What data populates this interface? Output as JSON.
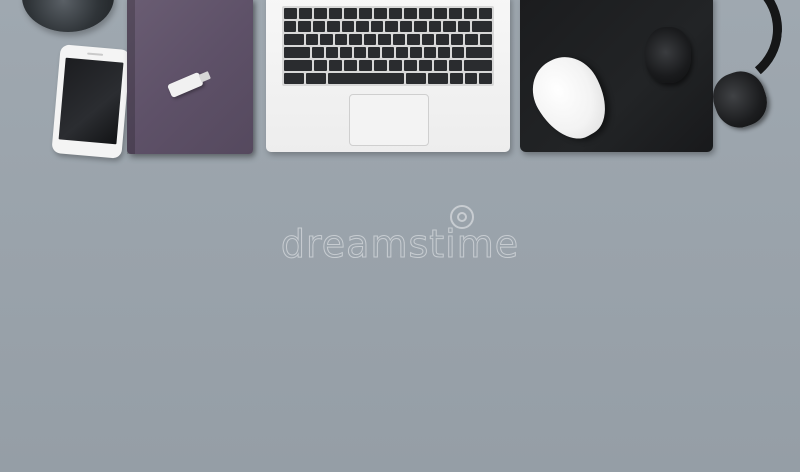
{
  "scene": {
    "background_color": "#9ba4ac",
    "objects": [
      {
        "name": "globe",
        "color": "#2f3438"
      },
      {
        "name": "smartphone",
        "color": "#f4f4f4"
      },
      {
        "name": "notebook",
        "color": "#5e5168"
      },
      {
        "name": "usb-flash-drive",
        "color": "#f1f1f1"
      },
      {
        "name": "laptop",
        "color": "#efefef"
      },
      {
        "name": "mousepad",
        "color": "#1f2022"
      },
      {
        "name": "mouse",
        "color": "#f5f5f5"
      },
      {
        "name": "headphones",
        "color": "#151617"
      }
    ]
  },
  "watermark": {
    "text": "dreamstime"
  }
}
